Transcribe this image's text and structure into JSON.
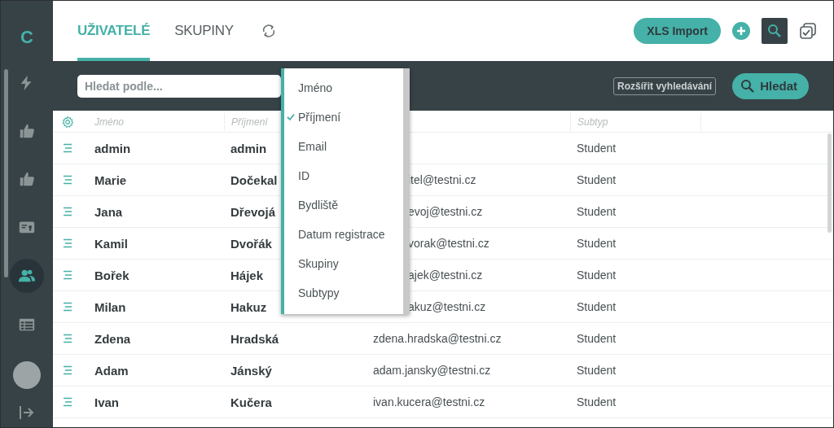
{
  "sidebar": {
    "logo": "C",
    "items": [
      {
        "kind": "bolt",
        "selected": false
      },
      {
        "kind": "thumb",
        "selected": false
      },
      {
        "kind": "thumb",
        "selected": false
      },
      {
        "kind": "card",
        "selected": false
      },
      {
        "kind": "users",
        "selected": true
      },
      {
        "kind": "table",
        "selected": false
      }
    ]
  },
  "tabs": [
    {
      "label": "UŽIVATELÉ",
      "selected": true
    },
    {
      "label": "SKUPINY",
      "selected": false
    }
  ],
  "actions": {
    "import": "XLS Import"
  },
  "search": {
    "placeholder": "Hledat podle...",
    "expand": "Rozšířit vyhledávání",
    "submit": "Hledat"
  },
  "table": {
    "columns": [
      "Jméno",
      "Příjmení",
      "",
      "Subtyp"
    ],
    "rows": [
      {
        "first": "admin",
        "last": "admin",
        "subtype": "Student"
      },
      {
        "first": "Marie",
        "last": "Dočekal",
        "email": "itel@testni.cz",
        "subtype": "Student",
        "covered": true
      },
      {
        "first": "Jana",
        "last": "Dřevojá",
        "email": "evoj@testni.cz",
        "subtype": "Student",
        "covered": true
      },
      {
        "first": "Kamil",
        "last": "Dvořák",
        "email": "vorak@testni.cz",
        "subtype": "Student",
        "covered": true
      },
      {
        "first": "Bořek",
        "last": "Hájek",
        "email": "ajek@testni.cz",
        "subtype": "Student",
        "covered": true
      },
      {
        "first": "Milan",
        "last": "Hakuz",
        "email": "akuz@testni.cz",
        "subtype": "Student",
        "covered": true
      },
      {
        "first": "Zdena",
        "last": "Hradská",
        "email": "zdena.hradska@testni.cz",
        "subtype": "Student",
        "covered": false
      },
      {
        "first": "Adam",
        "last": "Jánský",
        "email": "adam.jansky@testni.cz",
        "subtype": "Student",
        "covered": false
      },
      {
        "first": "Ivan",
        "last": "Kučera",
        "email": "ivan.kucera@testni.cz",
        "subtype": "Student",
        "covered": false
      }
    ]
  },
  "menu": {
    "items": [
      {
        "label": "Jméno",
        "checked": false
      },
      {
        "label": "Příjmení",
        "checked": true
      },
      {
        "label": "Email",
        "checked": false
      },
      {
        "label": "ID",
        "checked": false
      },
      {
        "label": "Bydliště",
        "checked": false
      },
      {
        "label": "Datum registrace",
        "checked": false
      },
      {
        "label": "Skupiny",
        "checked": false
      },
      {
        "label": "Subtypy",
        "checked": false
      }
    ]
  }
}
